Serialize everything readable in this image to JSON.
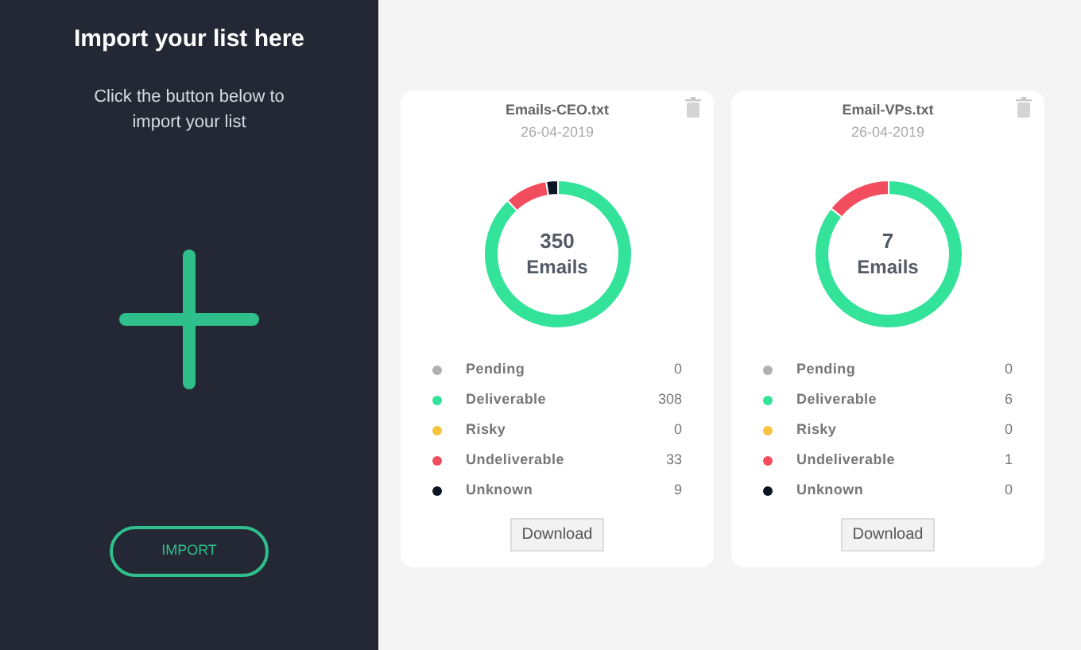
{
  "import_panel": {
    "title": "Import your list here",
    "subtitle": "Click the button below to import your list",
    "button": "IMPORT"
  },
  "lists": [
    {
      "file_name": "Emails-CEO.txt",
      "date": "26-04-2019",
      "total": "350",
      "total_label": "Emails",
      "download": "Download",
      "stats": [
        {
          "label": "Pending",
          "count": "0",
          "color": "#b0b0b0"
        },
        {
          "label": "Deliverable",
          "count": "308",
          "color": "#34e39a"
        },
        {
          "label": "Risky",
          "count": "0",
          "color": "#f7c23c"
        },
        {
          "label": "Undeliverable",
          "count": "33",
          "color": "#f24d5e"
        },
        {
          "label": "Unknown",
          "count": "9",
          "color": "#0d1424"
        }
      ],
      "chart_data": {
        "type": "donut",
        "values": [
          0,
          88,
          0,
          9.43,
          2.57
        ]
      }
    },
    {
      "file_name": "Email-VPs.txt",
      "date": "26-04-2019",
      "total": "7",
      "total_label": "Emails",
      "download": "Download",
      "stats": [
        {
          "label": "Pending",
          "count": "0",
          "color": "#b0b0b0"
        },
        {
          "label": "Deliverable",
          "count": "6",
          "color": "#34e39a"
        },
        {
          "label": "Risky",
          "count": "0",
          "color": "#f7c23c"
        },
        {
          "label": "Undeliverable",
          "count": "1",
          "color": "#f24d5e"
        },
        {
          "label": "Unknown",
          "count": "0",
          "color": "#0d1424"
        }
      ],
      "chart_data": {
        "type": "donut",
        "values": [
          0,
          85.71,
          0,
          14.29,
          0
        ]
      }
    }
  ]
}
